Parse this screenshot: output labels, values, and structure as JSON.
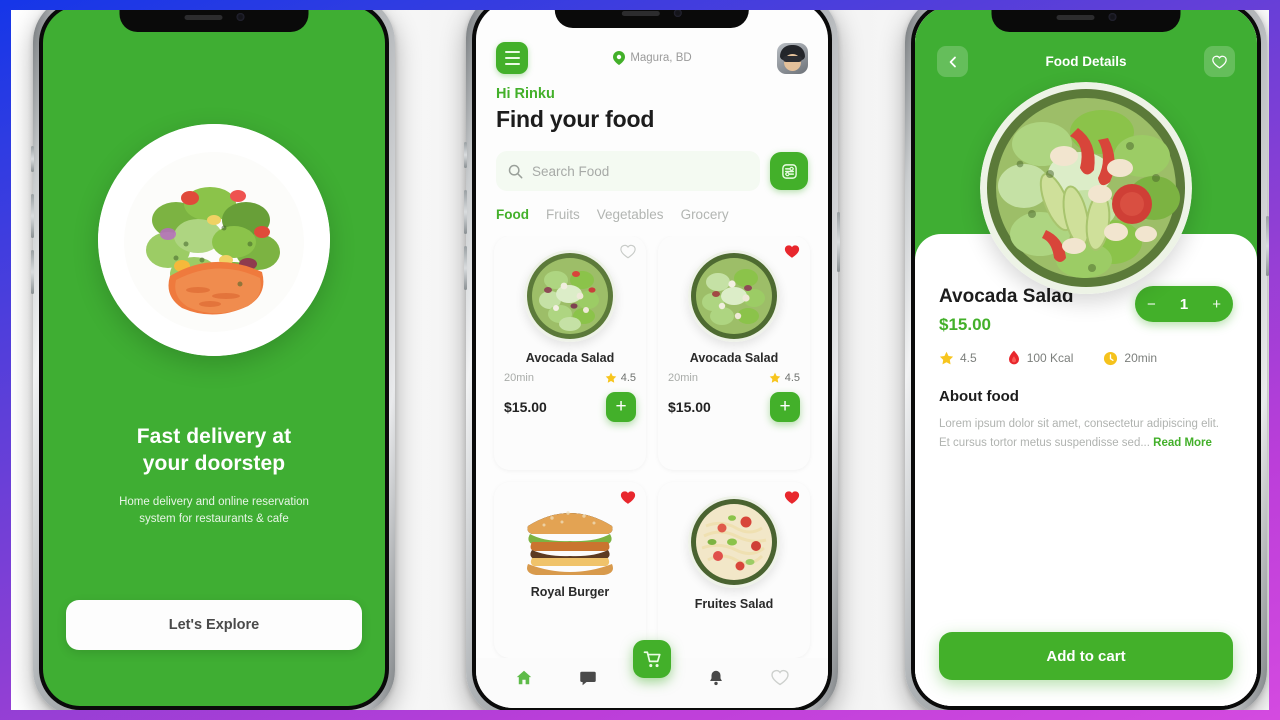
{
  "theme": {
    "brand_green": "#43b02a",
    "screen_green": "#3fae33",
    "heart_red": "#e8272d",
    "star_yellow": "#f7c51e",
    "frame_gradient_from": "#1536e8",
    "frame_gradient_to": "#d44ae0"
  },
  "onboarding": {
    "title_line1": "Fast delivery at",
    "title_line2": "your doorstep",
    "subtitle_line1": "Home delivery and online reservation",
    "subtitle_line2": "system for restaurants & cafe",
    "cta_label": "Let's Explore",
    "hero_icon": "salad-plate-image"
  },
  "home": {
    "menu_icon": "hamburger-menu-icon",
    "location_icon": "location-pin-icon",
    "location": "Magura, BD",
    "avatar_icon": "user-avatar",
    "greeting": "Hi Rinku",
    "heading": "Find your food",
    "search": {
      "icon": "search-icon",
      "placeholder": "Search Food",
      "value": "",
      "filter_icon": "filter-sliders-icon"
    },
    "categories": [
      {
        "label": "Food",
        "active": true
      },
      {
        "label": "Fruits",
        "active": false
      },
      {
        "label": "Vegetables",
        "active": false
      },
      {
        "label": "Grocery",
        "active": false
      }
    ],
    "products": [
      {
        "name": "Avocada Salad",
        "time": "20min",
        "rating": "4.5",
        "price": "$15.00",
        "favorite": false,
        "fav_icon": "heart-outline-icon",
        "add_icon": "plus-icon",
        "image": "avocado-salad-bowl"
      },
      {
        "name": "Avocada Salad",
        "time": "20min",
        "rating": "4.5",
        "price": "$15.00",
        "favorite": true,
        "fav_icon": "heart-filled-icon",
        "add_icon": "plus-icon",
        "image": "avocado-salad-bowl"
      },
      {
        "name": "Royal Burger",
        "time": "",
        "rating": "",
        "price": "",
        "favorite": true,
        "fav_icon": "heart-filled-icon",
        "add_icon": "plus-icon",
        "image": "royal-burger"
      },
      {
        "name": "Fruites Salad",
        "time": "",
        "rating": "",
        "price": "",
        "favorite": true,
        "fav_icon": "heart-filled-icon",
        "add_icon": "plus-icon",
        "image": "fruites-salad-bowl"
      }
    ],
    "tabbar": [
      {
        "name": "home",
        "icon": "home-icon",
        "active": true
      },
      {
        "name": "messages",
        "icon": "chat-icon",
        "active": false
      },
      {
        "name": "cart",
        "icon": "shopping-cart-icon",
        "active": false
      },
      {
        "name": "notifications",
        "icon": "bell-icon",
        "active": false
      },
      {
        "name": "favorites",
        "icon": "heart-outline-icon",
        "active": false
      }
    ]
  },
  "detail": {
    "back_icon": "chevron-left-icon",
    "title": "Food Details",
    "fav_icon": "heart-outline-icon",
    "hero_image": "avocado-salad-bowl",
    "name": "Avocada Salad",
    "price": "$15.00",
    "stepper": {
      "minus": "−",
      "quantity": "1",
      "plus": "+"
    },
    "stats": [
      {
        "icon": "star-icon",
        "value": "4.5"
      },
      {
        "icon": "flame-calorie-icon",
        "value": "100 Kcal"
      },
      {
        "icon": "clock-icon",
        "value": "20min"
      }
    ],
    "about_heading": "About food",
    "about_text": "Lorem ipsum dolor sit amet, consectetur adipiscing elit. Et cursus tortor metus suspendisse sed...",
    "read_more": "Read More",
    "cta_label": "Add to cart"
  }
}
